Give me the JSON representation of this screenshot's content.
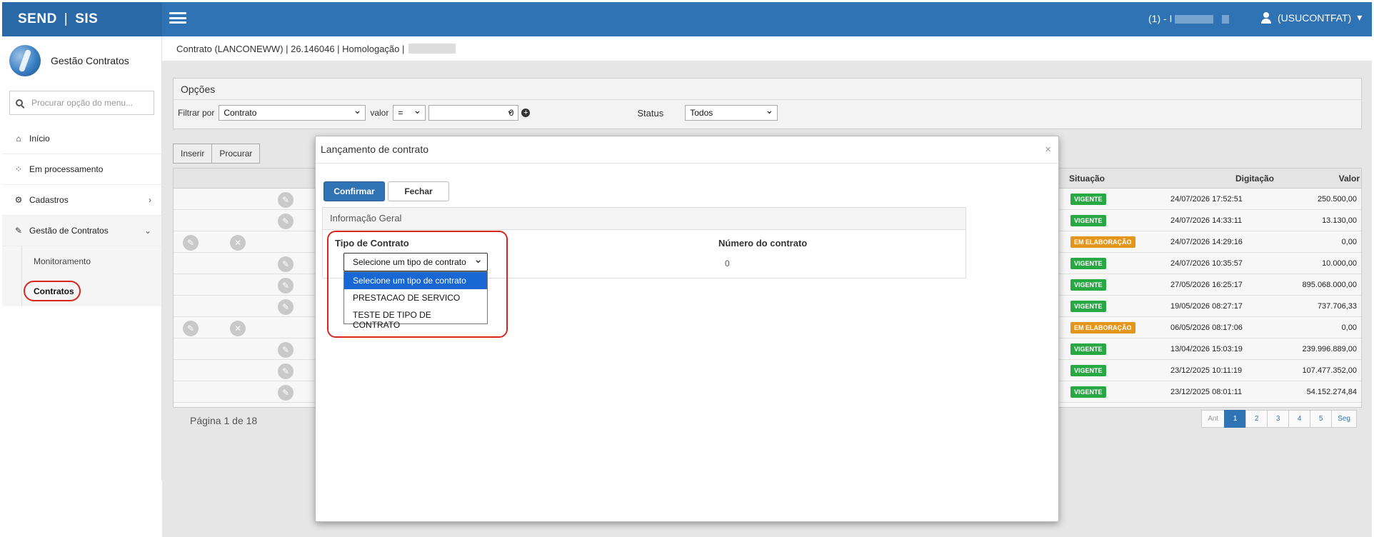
{
  "header": {
    "brand_left": "SEND",
    "brand_sep": "|",
    "brand_right": "SIS",
    "company": "(1) - I",
    "user": "(USUCONTFAT)",
    "user_caret": "▾"
  },
  "sidebar": {
    "app_title": "Gestão Contratos",
    "search_placeholder": "Procurar opção do menu...",
    "items": [
      {
        "label": "Início",
        "icon": "home-icon"
      },
      {
        "label": "Em processamento",
        "icon": "spinner-icon"
      },
      {
        "label": "Cadastros",
        "icon": "gears-icon",
        "chevron": "›"
      },
      {
        "label": "Gestão de Contratos",
        "icon": "edit-icon",
        "chevron": "⌄"
      }
    ],
    "subitems": [
      "Monitoramento",
      "Contratos"
    ]
  },
  "breadcrumb": {
    "text": "Contrato (LANCONEWW) | 26.146046 | Homologação |"
  },
  "opcoes": {
    "title": "Opções",
    "filtrar_label": "Filtrar por",
    "filtrar_value": "Contrato",
    "valor_label": "valor",
    "op_value": "=",
    "valor_input": "0",
    "status_label": "Status",
    "status_value": "Todos"
  },
  "actions": {
    "inserir": "Inserir",
    "procurar": "Procurar"
  },
  "table": {
    "headers": {
      "situacao": "Situação",
      "digitacao": "Digitação",
      "valor": "Valor"
    },
    "rows": [
      {
        "status": "VIGENTE",
        "type": "vig",
        "digitacao": "24/07/2026 17:52:51",
        "valor": "250.500,00",
        "x": false
      },
      {
        "status": "VIGENTE",
        "type": "vig",
        "digitacao": "24/07/2026 14:33:11",
        "valor": "13.130,00",
        "x": false
      },
      {
        "status": "EM ELABORAÇÃO",
        "type": "ela",
        "digitacao": "24/07/2026 14:29:16",
        "valor": "0,00",
        "x": true
      },
      {
        "status": "VIGENTE",
        "type": "vig",
        "digitacao": "24/07/2026 10:35:57",
        "valor": "10.000,00",
        "x": false
      },
      {
        "status": "VIGENTE",
        "type": "vig",
        "digitacao": "27/05/2026 16:25:17",
        "valor": "895.068.000,00",
        "x": false
      },
      {
        "status": "VIGENTE",
        "type": "vig",
        "digitacao": "19/05/2026 08:27:17",
        "valor": "737.706,33",
        "x": false
      },
      {
        "status": "EM ELABORAÇÃO",
        "type": "ela",
        "digitacao": "06/05/2026 08:17:06",
        "valor": "0,00",
        "x": true
      },
      {
        "status": "VIGENTE",
        "type": "vig",
        "digitacao": "13/04/2026 15:03:19",
        "valor": "239.996.889,00",
        "x": false
      },
      {
        "status": "VIGENTE",
        "type": "vig",
        "digitacao": "23/12/2025 10:11:19",
        "valor": "107.477.352,00",
        "x": false
      },
      {
        "status": "VIGENTE",
        "type": "vig",
        "digitacao": "23/12/2025 08:01:11",
        "valor": "54.152.274,84",
        "x": false
      }
    ],
    "pager_text": "Página 1 de 18",
    "pages": [
      "Ant",
      "1",
      "2",
      "3",
      "4",
      "5",
      "Seg"
    ],
    "active_page": "1"
  },
  "modal": {
    "title": "Lançamento de contrato",
    "close": "×",
    "confirm": "Confirmar",
    "close_btn": "Fechar",
    "panel_title": "Informação Geral",
    "tipo_label": "Tipo de Contrato",
    "numero_label": "Número do contrato",
    "numero_value": "0",
    "tipo_selected": "Selecione um tipo de contrato",
    "options": [
      "Selecione um tipo de contrato",
      "PRESTACAO DE SERVICO",
      "TESTE DE TIPO DE CONTRATO"
    ]
  },
  "colors": {
    "primary": "#2f73b4",
    "vigente": "#27a843",
    "elaboracao": "#e5951a",
    "highlight": "#d9261c"
  }
}
